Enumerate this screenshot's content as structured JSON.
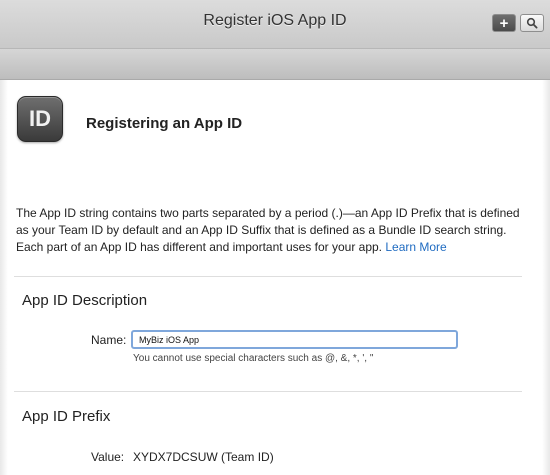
{
  "header": {
    "title": "Register iOS App ID",
    "add_symbol": "+"
  },
  "icons": {
    "add": "plus-icon",
    "search": "search-icon",
    "app": "app-id-icon"
  },
  "app_icon": {
    "label": "ID"
  },
  "page": {
    "heading": "Registering an App ID",
    "intro": "The App ID string contains two parts separated by a period (.)—an App ID Prefix that is defined as your Team ID by default and an App ID Suffix that is defined as a Bundle ID search string. Each part of an App ID has different and important uses for your app.",
    "learn_more": "Learn More"
  },
  "description_section": {
    "title": "App ID Description",
    "name_label": "Name:",
    "name_value": "MyBiz iOS App",
    "hint": "You cannot use special characters such as @, &, *, ', \""
  },
  "prefix_section": {
    "title": "App ID Prefix",
    "value_label": "Value:",
    "value": "XYDX7DCSUW (Team ID)"
  },
  "colors": {
    "link": "#1f6bc1",
    "input_focus": "#7fa7db",
    "header": "#d0d0d0"
  }
}
